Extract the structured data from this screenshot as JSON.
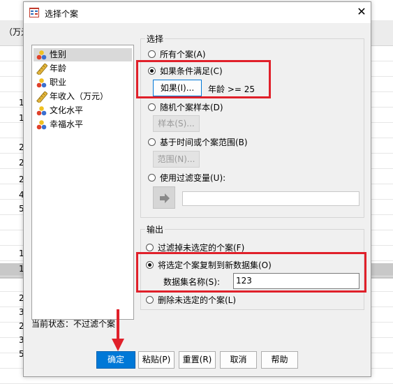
{
  "background": {
    "header_text": "（万元",
    "row_digits": [
      "1",
      "1",
      "2",
      "2",
      "2",
      "4",
      "5",
      "1",
      "1",
      "2",
      "3",
      "2",
      "3",
      "5"
    ]
  },
  "dialog": {
    "title": "选择个案",
    "close_glyph": "✕",
    "variables": [
      {
        "label": "性别",
        "type": "nominal",
        "selected": true
      },
      {
        "label": "年龄",
        "type": "scale",
        "selected": false
      },
      {
        "label": "职业",
        "type": "nominal",
        "selected": false
      },
      {
        "label": "年收入（万元）",
        "type": "scale",
        "selected": false
      },
      {
        "label": "文化水平",
        "type": "nominal",
        "selected": false
      },
      {
        "label": "幸福水平",
        "type": "nominal",
        "selected": false
      }
    ],
    "select_group": {
      "title": "选择",
      "all_cases": "所有个案(A)",
      "if_condition": "如果条件满足(C)",
      "if_button": "如果(I)...",
      "condition_text": "年龄 >= 25",
      "random_sample": "随机个案样本(D)",
      "sample_button": "样本(S)...",
      "time_range": "基于时间或个案范围(B)",
      "range_button": "范围(N)...",
      "filter_var": "使用过滤变量(U):",
      "filter_value": ""
    },
    "output_group": {
      "title": "输出",
      "filter_out": "过滤掉未选定的个案(F)",
      "copy_new": "将选定个案复制到新数据集(O)",
      "dataset_name_label": "数据集名称(S):",
      "dataset_name_value": "123",
      "delete_unselected": "删除未选定的个案(L)"
    },
    "status": "当前状态：不过滤个案",
    "buttons": {
      "ok": "确定",
      "paste": "粘贴(P)",
      "reset": "重置(R)",
      "cancel": "取消",
      "help": "帮助"
    },
    "colors": {
      "annotation_red": "#e0202a",
      "accent_blue": "#0078d7"
    }
  }
}
